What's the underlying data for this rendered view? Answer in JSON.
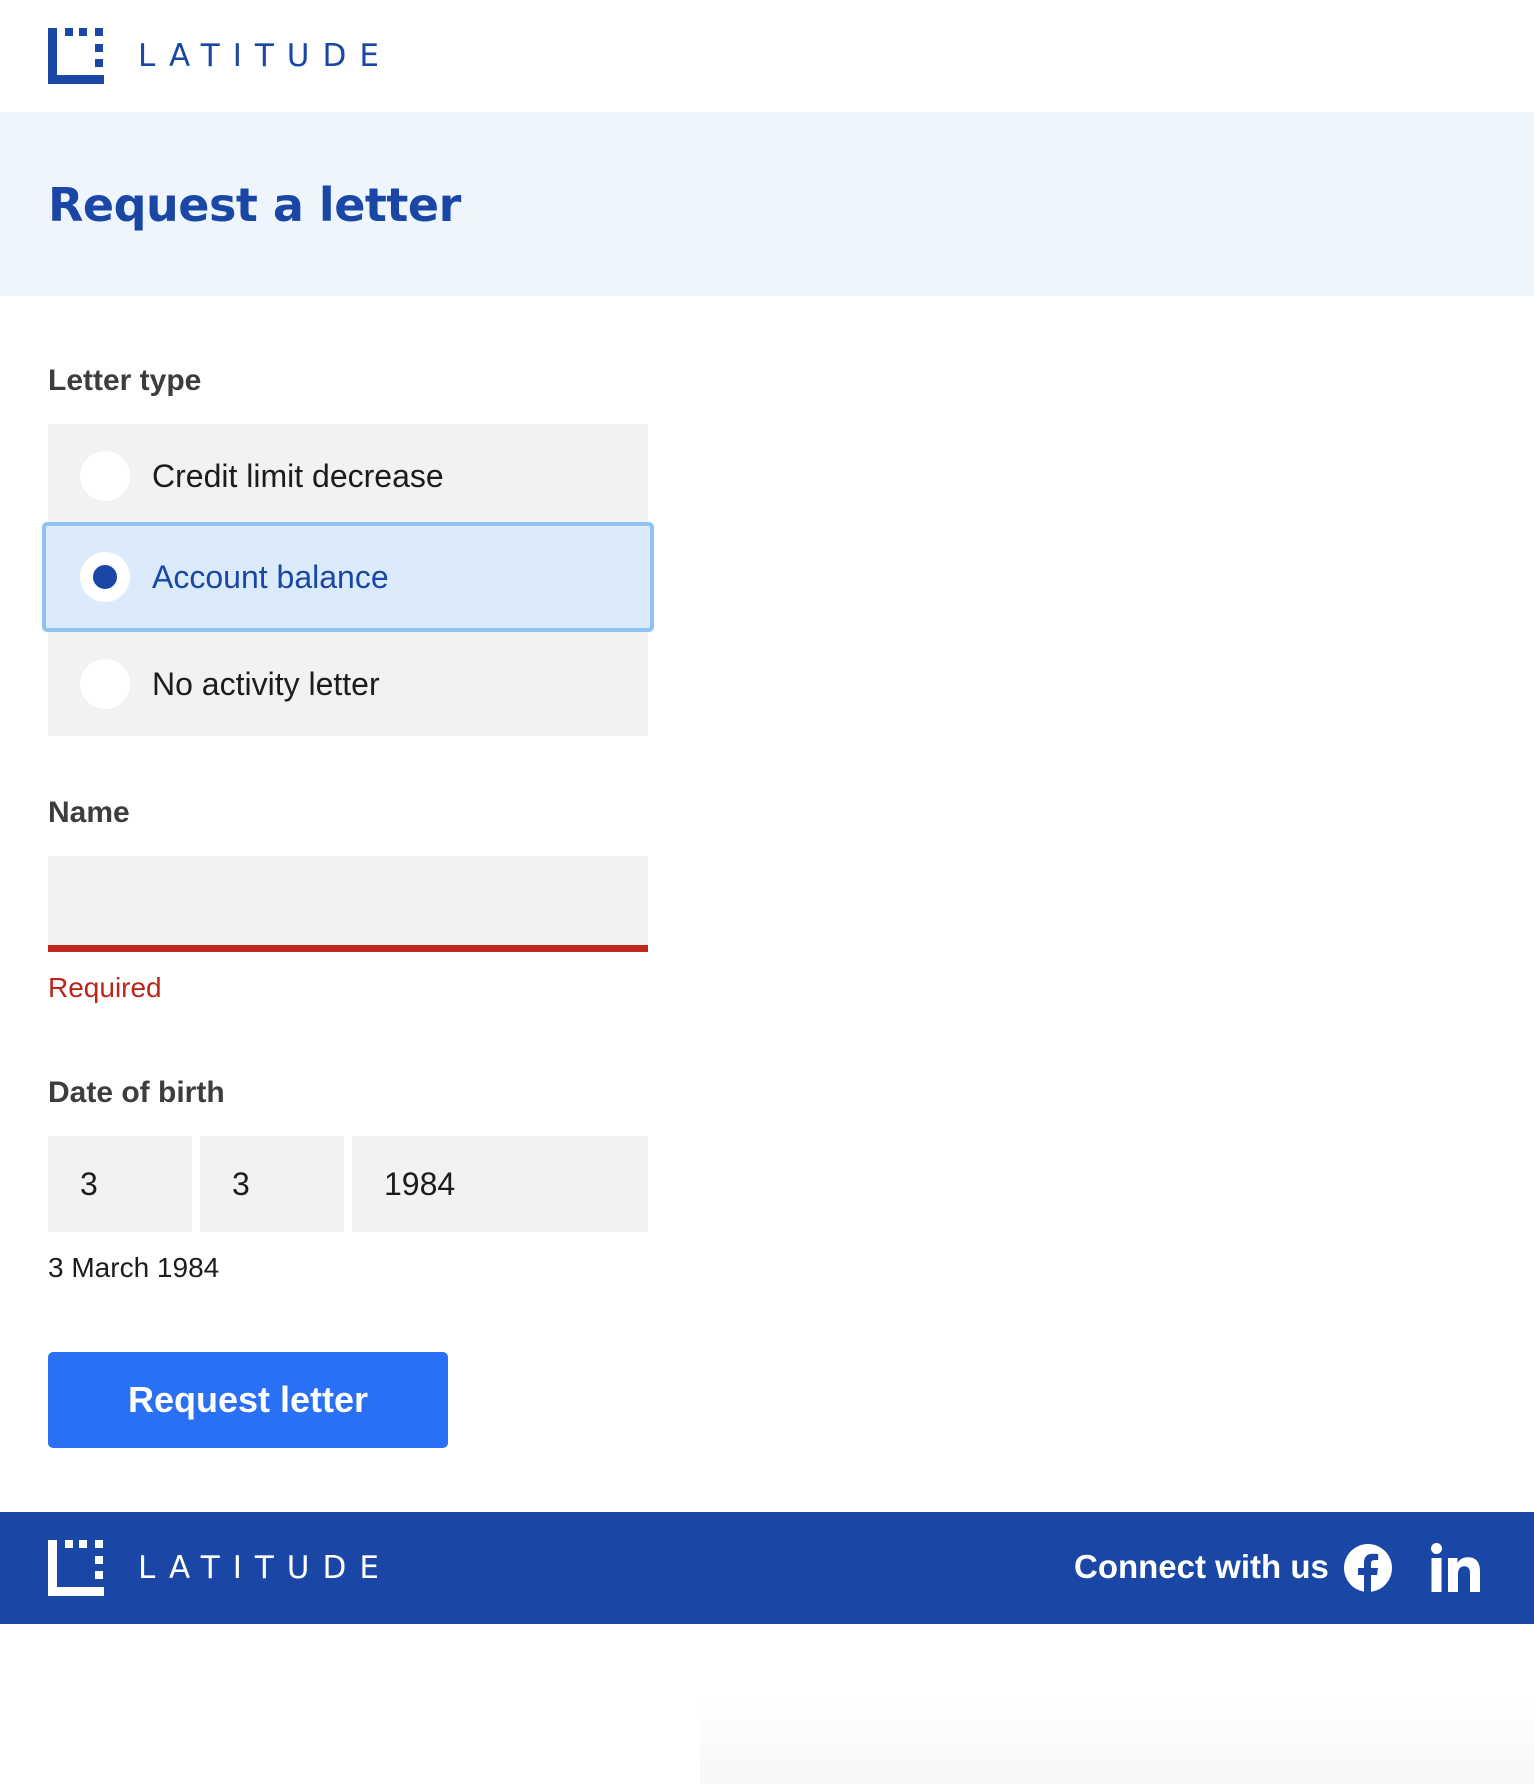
{
  "header": {
    "logo_text": "LATITUDE",
    "logo_icon": "latitude-logo-mark"
  },
  "banner": {
    "title": "Request a letter"
  },
  "letter_type": {
    "label": "Letter type",
    "options": [
      {
        "label": "Credit limit decrease",
        "selected": false
      },
      {
        "label": "Account balance",
        "selected": true
      },
      {
        "label": "No activity letter",
        "selected": false
      }
    ]
  },
  "name": {
    "label": "Name",
    "value": "",
    "error": "Required"
  },
  "date_of_birth": {
    "label": "Date of birth",
    "day": "3",
    "month": "3",
    "year": "1984",
    "summary": "3 March 1984"
  },
  "submit": {
    "label": "Request letter"
  },
  "footer": {
    "logo_text": "LATITUDE",
    "connect_text": "Connect with us",
    "social_icons": [
      "facebook-icon",
      "linkedin-icon"
    ]
  },
  "colors": {
    "brand_blue": "#1a47a5",
    "button_blue": "#2970f5",
    "banner_bg": "#eef5fd",
    "selected_bg": "#dcebfc",
    "selected_border": "#90c2f2",
    "error_red": "#c2271c",
    "field_bg": "#f2f2f2"
  }
}
